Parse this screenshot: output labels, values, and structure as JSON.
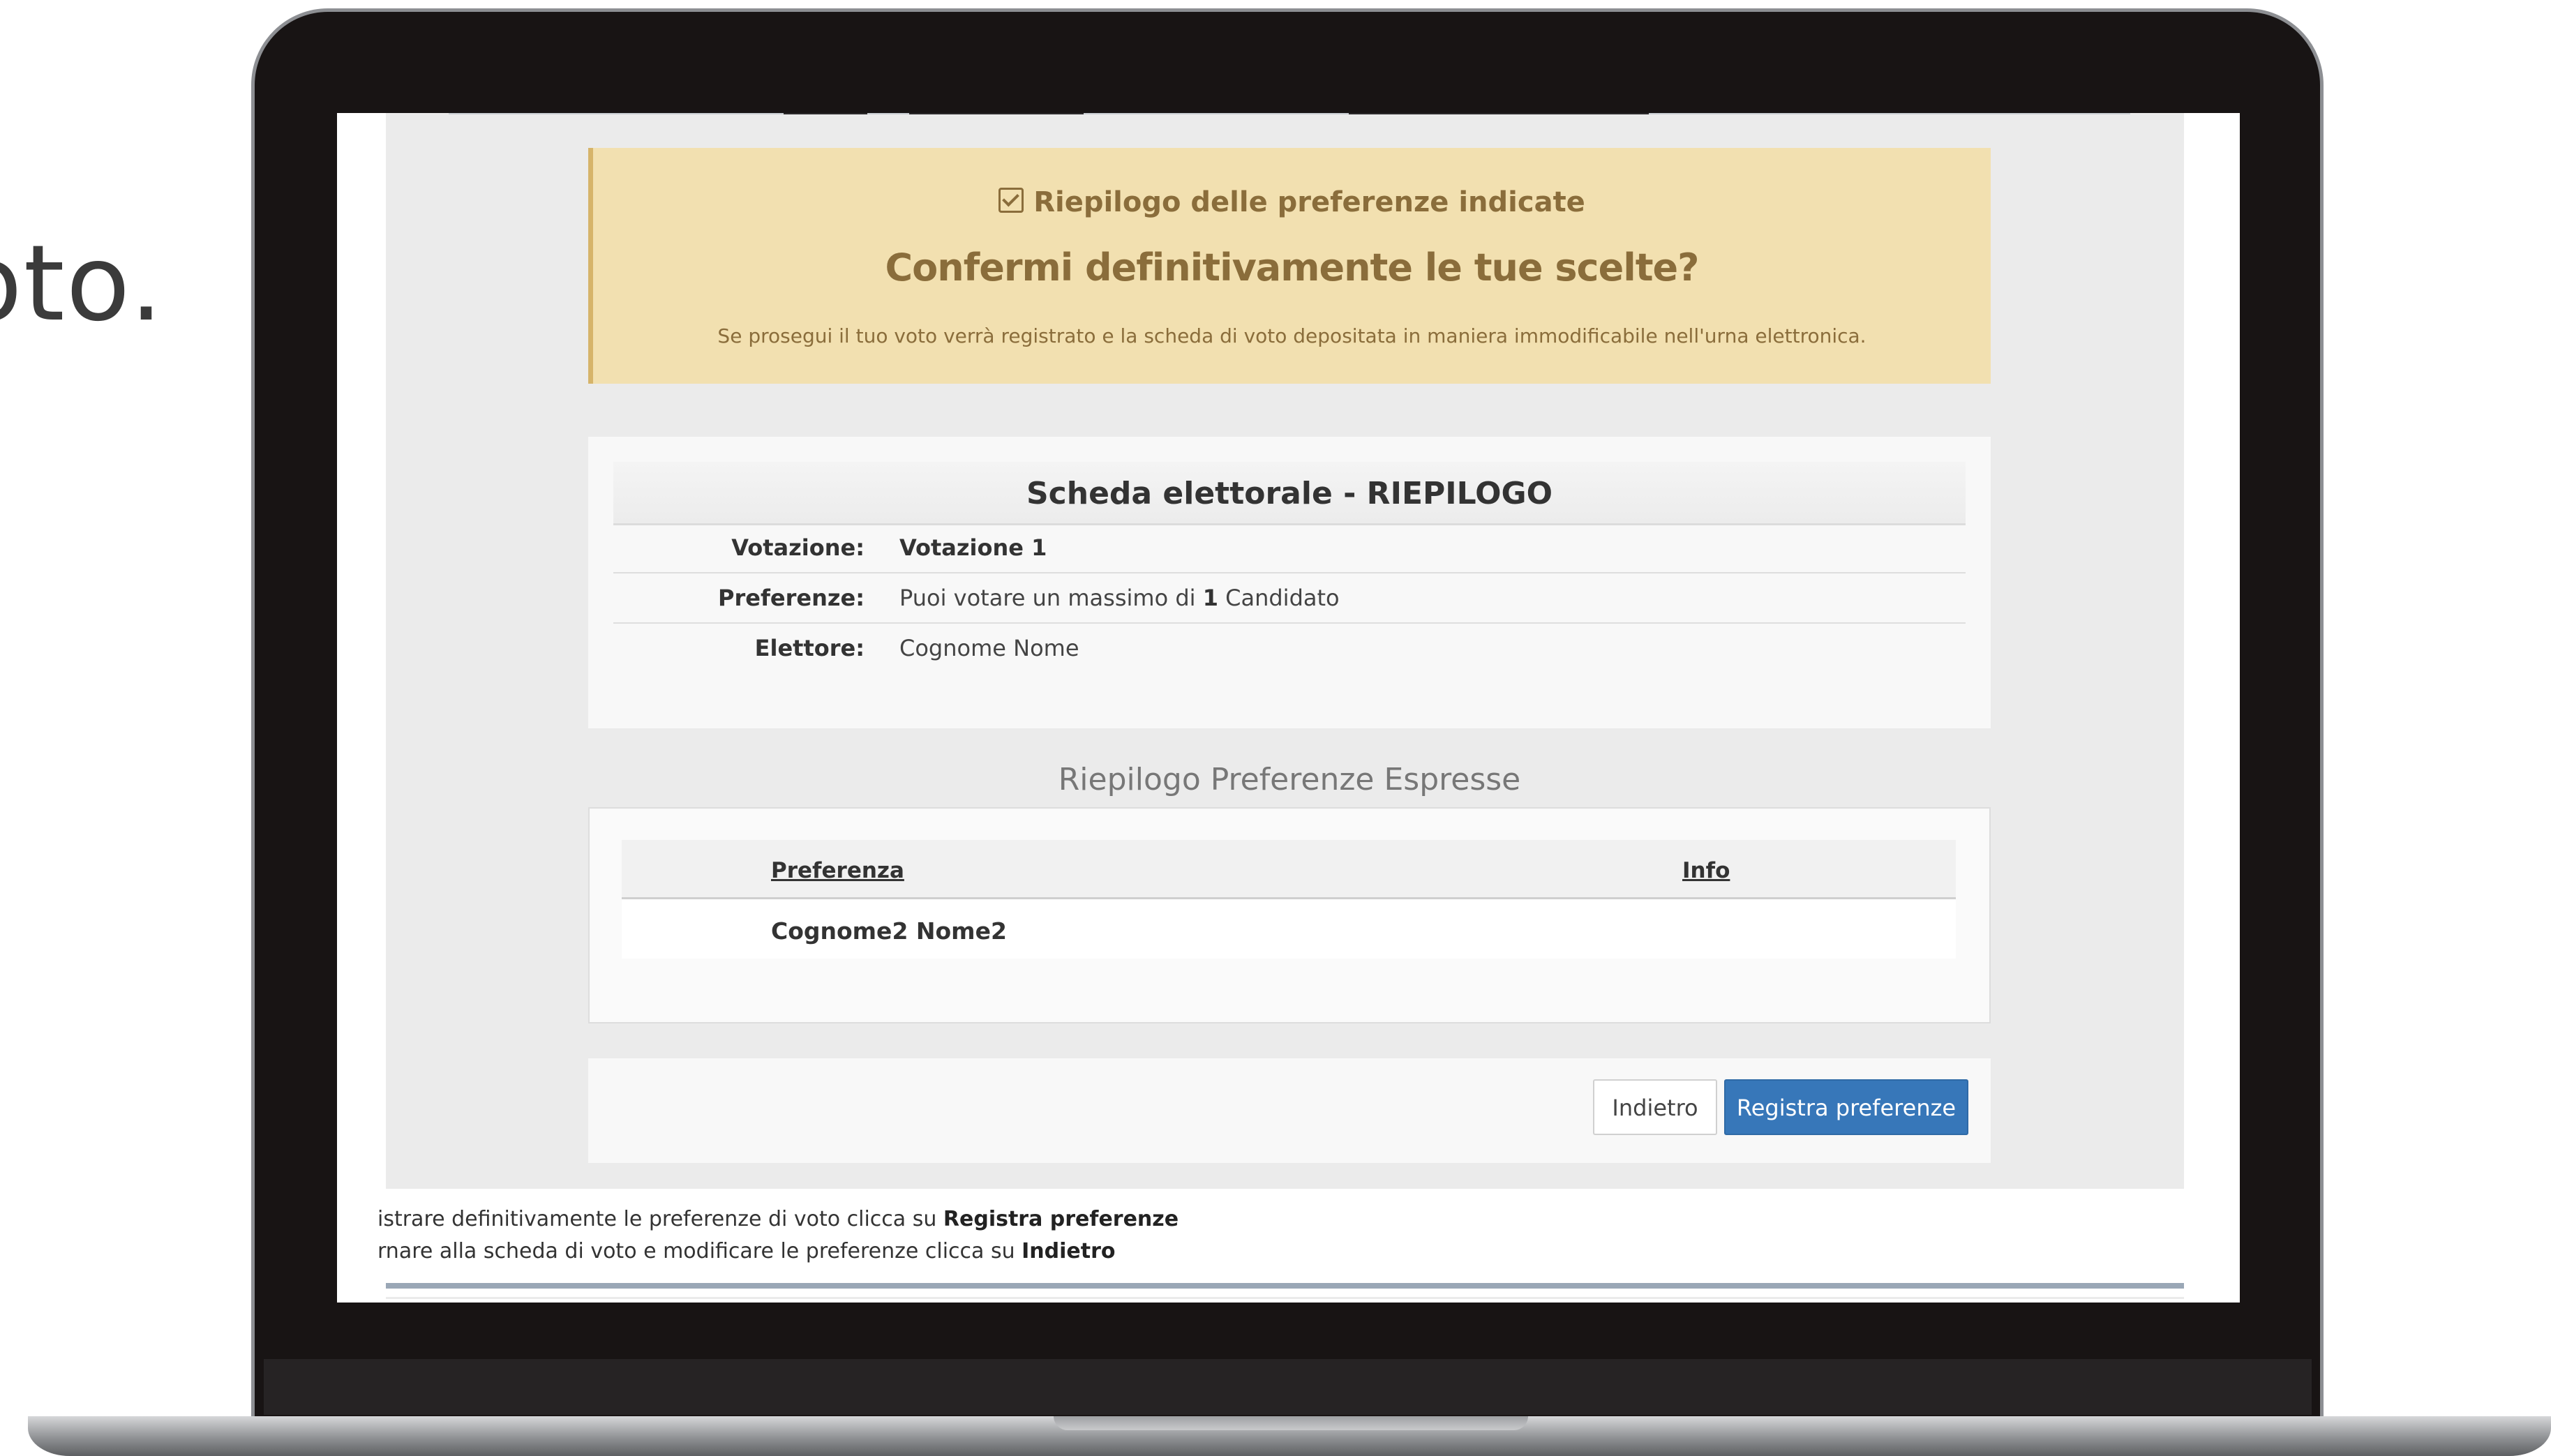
{
  "slide": {
    "fragment_text": "oto."
  },
  "alert": {
    "title": "Riepilogo delle preferenze indicate",
    "heading": "Confermi definitivamente le tue scelte?",
    "text": "Se prosegui il tuo voto verrà registrato e la scheda di voto depositata in maniera immodificabile nell'urna elettronica."
  },
  "summary": {
    "title": "Scheda elettorale - RIEPILOGO",
    "rows": [
      {
        "label": "Votazione:",
        "value": "Votazione 1"
      },
      {
        "label": "Preferenze:",
        "value_prefix": "Puoi votare un massimo di ",
        "value_strong": "1",
        "value_suffix": " Candidato"
      },
      {
        "label": "Elettore:",
        "value": "Cognome Nome"
      }
    ]
  },
  "preferences": {
    "section_title": "Riepilogo Preferenze Espresse",
    "columns": [
      "Preferenza",
      "Info"
    ],
    "rows": [
      {
        "preferenza": "Cognome2 Nome2",
        "info": ""
      }
    ]
  },
  "actions": {
    "back_label": "Indietro",
    "save_label": "Registra preferenze"
  },
  "help": {
    "line1_prefix": "istrare definitivamente le preferenze di voto clicca su ",
    "line1_strong": "Registra preferenze",
    "line2_prefix": "rnare alla scheda di voto e modificare le preferenze clicca su ",
    "line2_strong": "Indietro"
  },
  "colors": {
    "alert_background": "#f2e0b0",
    "alert_text": "#8a6d3b",
    "primary_button": "#3777b9"
  }
}
